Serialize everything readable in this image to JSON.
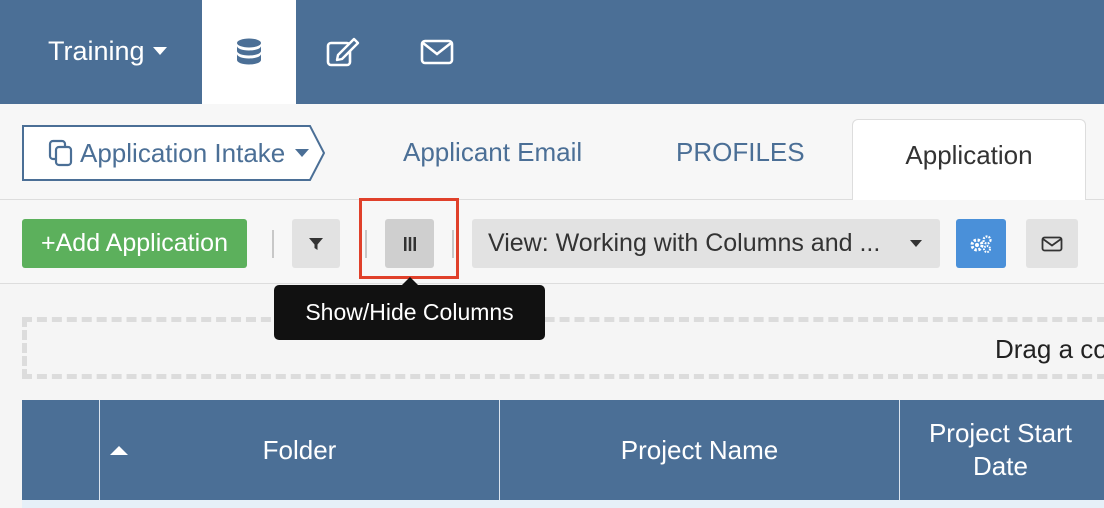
{
  "nav": {
    "workspace": "Training",
    "icons": [
      "database-icon",
      "edit-icon",
      "mail-icon"
    ]
  },
  "tabs": {
    "breadcrumb": "Application Intake",
    "items": [
      "Applicant Email",
      "PROFILES"
    ],
    "active": "Application"
  },
  "toolbar": {
    "add_label": "+Add Application",
    "view_label": "View: Working with Columns and ..."
  },
  "tooltip": {
    "text": "Show/Hide Columns"
  },
  "group_area": {
    "text": "Drag a co"
  },
  "grid": {
    "columns": [
      "Folder",
      "Project Name",
      "Project Start Date"
    ]
  },
  "colors": {
    "nav": "#4b6f96",
    "add_button": "#5cb05c",
    "settings_button": "#4a90d9",
    "highlight": "#e0402a"
  }
}
